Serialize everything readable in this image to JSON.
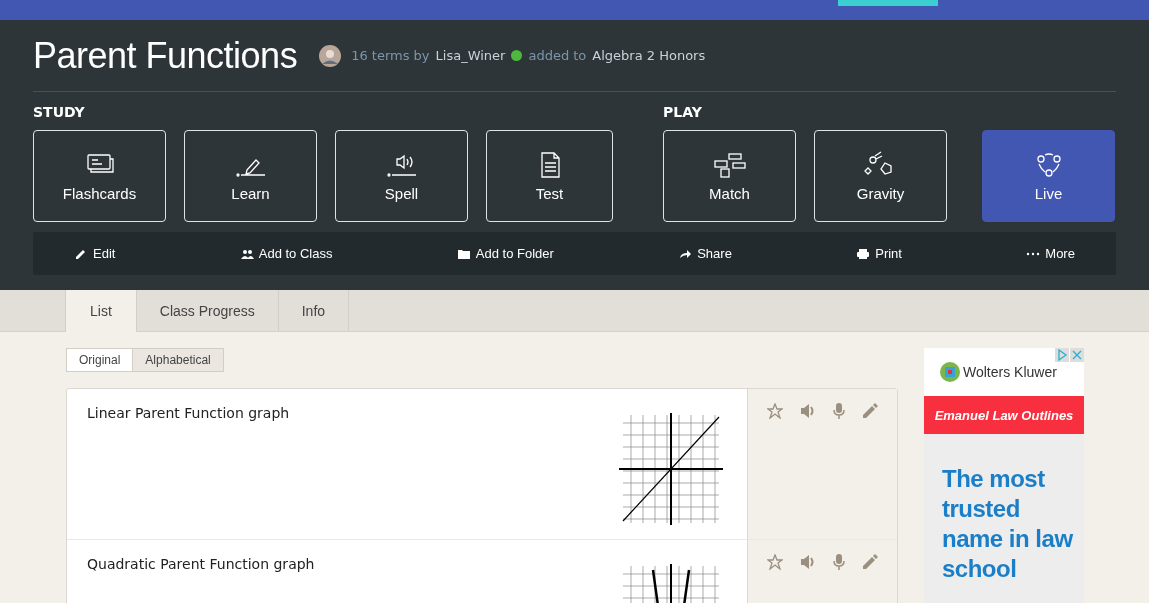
{
  "header": {
    "title": "Parent Functions",
    "meta_terms": "16 terms by",
    "author": "Lisa_Winer",
    "online": true,
    "meta_added": "added to",
    "class_name": "Algebra 2 Honors"
  },
  "mode_groups": [
    {
      "label": "STUDY",
      "modes": [
        {
          "label": "Flashcards",
          "kind": "flashcards",
          "selected": false
        },
        {
          "label": "Learn",
          "kind": "learn",
          "selected": false
        },
        {
          "label": "Spell",
          "kind": "spell",
          "selected": false
        },
        {
          "label": "Test",
          "kind": "test",
          "selected": false
        }
      ]
    },
    {
      "label": "PLAY",
      "modes": [
        {
          "label": "Match",
          "kind": "match",
          "selected": false
        },
        {
          "label": "Gravity",
          "kind": "gravity",
          "selected": false
        },
        {
          "label": "Live",
          "kind": "live",
          "selected": true
        }
      ]
    }
  ],
  "actions": [
    {
      "label": "Edit",
      "kind": "edit"
    },
    {
      "label": "Add to Class",
      "kind": "class"
    },
    {
      "label": "Add to Folder",
      "kind": "folder"
    },
    {
      "label": "Share",
      "kind": "share"
    },
    {
      "label": "Print",
      "kind": "print"
    },
    {
      "label": "More",
      "kind": "more"
    }
  ],
  "tabs": [
    {
      "label": "List",
      "selected": true
    },
    {
      "label": "Class Progress",
      "selected": false
    },
    {
      "label": "Info",
      "selected": false
    }
  ],
  "sort": [
    {
      "label": "Original",
      "selected": true
    },
    {
      "label": "Alphabetical",
      "selected": false
    }
  ],
  "terms": [
    {
      "term": "Linear Parent Function graph",
      "kind": "linear"
    },
    {
      "term": "Quadratic Parent Function graph",
      "kind": "quadratic"
    }
  ],
  "ad": {
    "brand": "Wolters Kluwer",
    "banner": "Emanuel Law Outlines",
    "headline": "The most trusted name in law school"
  }
}
